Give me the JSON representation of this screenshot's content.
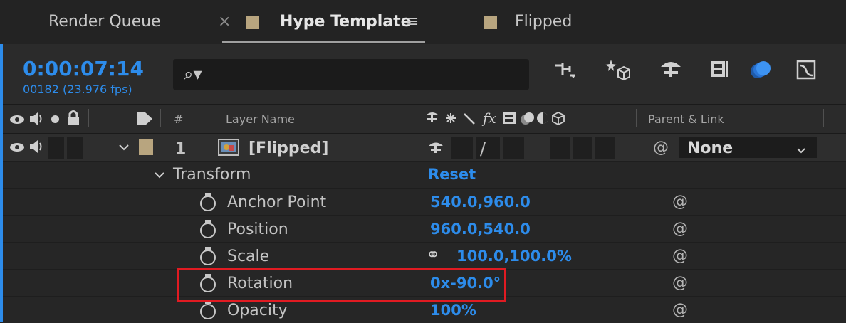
{
  "tabs": [
    {
      "label": "Render Queue"
    },
    {
      "label": "Hype Template",
      "close": "×",
      "menu": "≡",
      "swatch": "#b8a57f"
    },
    {
      "label": "Flipped",
      "swatch": "#b8a57f"
    }
  ],
  "timeline": {
    "timecode": "0:00:07:14",
    "frame_fps": "00182 (23.976 fps)",
    "search_glyph": "⌕▾",
    "accent": "#2d8ceb"
  },
  "toolbar_icons": [
    "composition-flowchart-icon",
    "draft-3d-icon",
    "shy-layers-icon",
    "frame-blending-icon",
    "motion-blur-icon",
    "graph-editor-icon"
  ],
  "columns": {
    "hash": "#",
    "layer_name": "Layer Name",
    "parent_link": "Parent & Link",
    "switch_fx": "fx"
  },
  "layer": {
    "number": "1",
    "name": "[Flipped]",
    "parent": "None",
    "switch_slash": "/"
  },
  "transform": {
    "label": "Transform",
    "reset": "Reset"
  },
  "properties": [
    {
      "label": "Anchor Point",
      "value": "540.0,960.0"
    },
    {
      "label": "Position",
      "value": "960.0,540.0"
    },
    {
      "label": "Scale",
      "value": "100.0,100.0%",
      "link": "⚭"
    },
    {
      "label": "Rotation",
      "value": "0x-90.0°"
    },
    {
      "label": "Opacity",
      "value": "100%"
    }
  ],
  "highlight_color": "#e11b22"
}
